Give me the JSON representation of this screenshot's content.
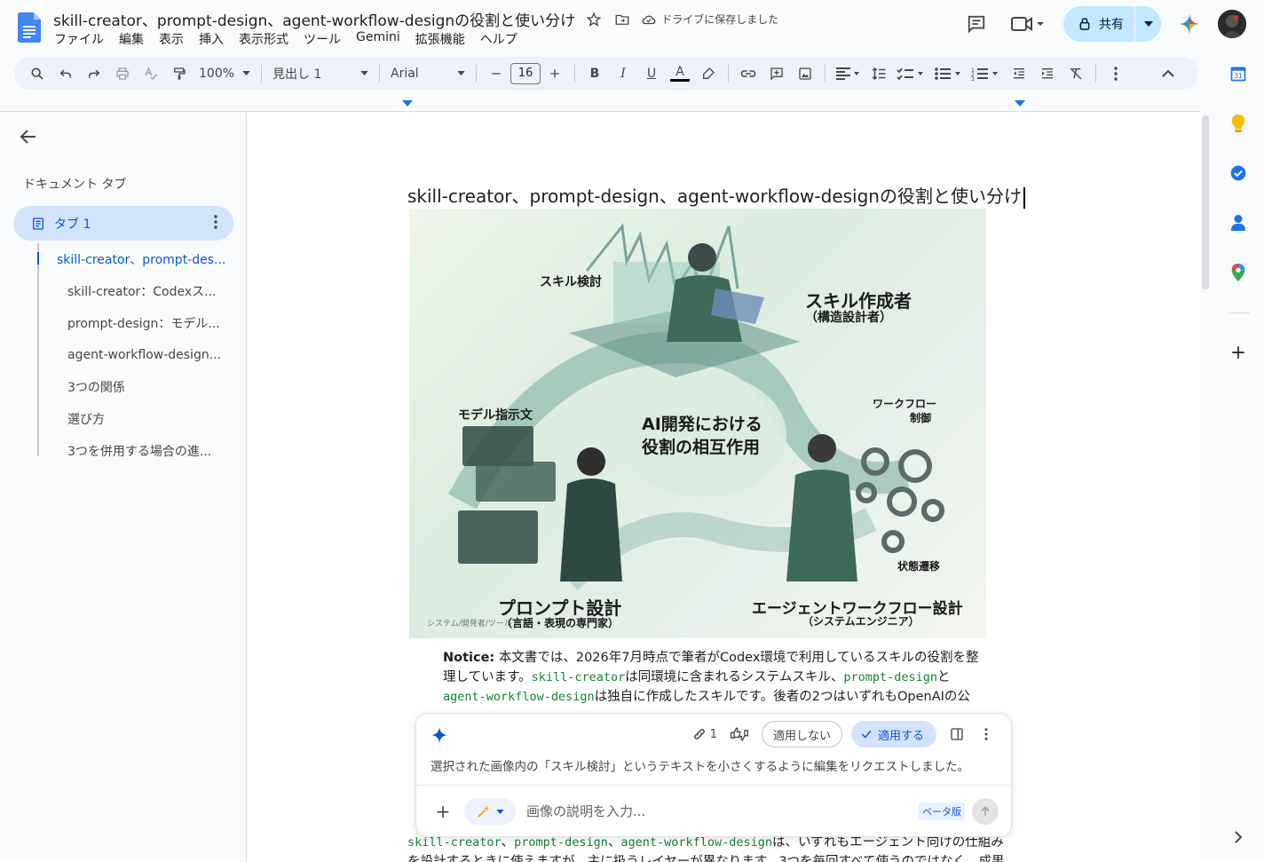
{
  "window": {
    "doc_title": "skill-creator、prompt-design、agent-workflow-designの役割と使い分け",
    "save_status": "ドライブに保存しました"
  },
  "menu": [
    "ファイル",
    "編集",
    "表示",
    "挿入",
    "表示形式",
    "ツール",
    "Gemini",
    "拡張機能",
    "ヘルプ"
  ],
  "header_actions": {
    "share_label": "共有"
  },
  "toolbar": {
    "zoom": "100%",
    "style": "見出し 1",
    "font": "Arial",
    "font_size": "16"
  },
  "sidebar": {
    "heading": "ドキュメント タブ",
    "tab_label": "タブ 1",
    "outline": [
      {
        "label": "skill-creator、prompt-des..."
      },
      {
        "label": "skill-creator：Codexス..."
      },
      {
        "label": "prompt-design：モデル..."
      },
      {
        "label": "agent-workflow-design..."
      },
      {
        "label": "3つの関係"
      },
      {
        "label": "選び方"
      },
      {
        "label": "3つを併用する場合の進..."
      }
    ]
  },
  "document": {
    "heading": "skill-creator、prompt-design、agent-workflow-designの役割と使い分け",
    "illustration": {
      "center_title_1": "AI開発における",
      "center_title_2": "役割の相互作用",
      "skill_review": "スキル検討",
      "skill_creator": "スキル作成者",
      "skill_creator_sub": "（構造設計者）",
      "model_instruction": "モデル指示文",
      "workflow_control_1": "ワークフロー",
      "workflow_control_2": "制御",
      "state_transition": "状態遷移",
      "prompt_design": "プロンプト設計",
      "prompt_design_sub": "（言語・表現の専門家）",
      "agent_workflow": "エージェントワークフロー設計",
      "agent_workflow_sub": "（システムエンジニア）",
      "screen_text": "システム/開発者/ツール"
    },
    "notice_label": "Notice:",
    "notice_text_1": " 本文書では、2026年7月時点で筆者がCodex環境で利用しているスキルの役割を整理しています。",
    "notice_code_1": "skill-creator",
    "notice_text_2": "は同環境に含まれるシステムスキル、",
    "notice_code_2": "prompt-design",
    "notice_text_3": "と",
    "notice_code_3": "agent-workflow-design",
    "notice_text_4": "は独自に作成したスキルです。後者の2つはいずれもOpenAIの公",
    "bottom_code_1": "skill-creator",
    "bottom_sep_1": "、",
    "bottom_code_2": "prompt-design",
    "bottom_sep_2": "、",
    "bottom_code_3": "agent-workflow-design",
    "bottom_text_1": "は、いずれもエージェント向けの仕組み",
    "bottom_text_2": "を設計するときに使えますが、主に扱うレイヤーが異なります。3つを毎回すべて使うのではなく、成果物が"
  },
  "ai_panel": {
    "link_count": "1",
    "reject_label": "適用しない",
    "apply_label": "適用する",
    "message": "選択された画像内の「スキル検討」というテキストを小さくするように編集をリクエストしました。",
    "input_placeholder": "画像の説明を入力...",
    "beta_label": "ベータ版"
  },
  "rightrail": {
    "calendar_day": "31"
  },
  "colors": {
    "accent": "#0b57d0",
    "share_bg": "#c2e7ff",
    "code_green": "#188038"
  }
}
